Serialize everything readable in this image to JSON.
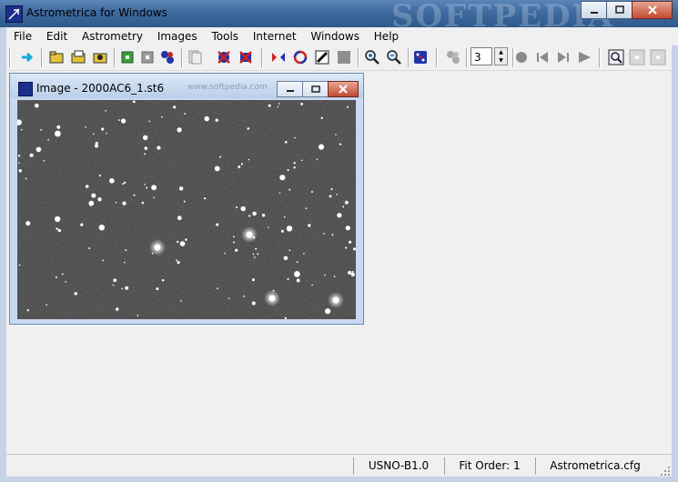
{
  "window": {
    "title": "Astrometrica for Windows",
    "watermark": "SOFTPEDIA"
  },
  "menu": [
    "File",
    "Edit",
    "Astrometry",
    "Images",
    "Tools",
    "Internet",
    "Windows",
    "Help"
  ],
  "toolbar": {
    "spin_value": "3"
  },
  "image_window": {
    "title": "Image - 2000AC6_1.st6",
    "watermark": "www.softpedia.com"
  },
  "status": {
    "catalog": "USNO-B1.0",
    "fit_order": "Fit Order: 1",
    "config": "Astrometrica.cfg"
  },
  "colors": {
    "title_bar": "#3e6a9f",
    "frame": "#c5d3e4",
    "close_red": "#c24a30",
    "sky": "#2a2a2a"
  }
}
